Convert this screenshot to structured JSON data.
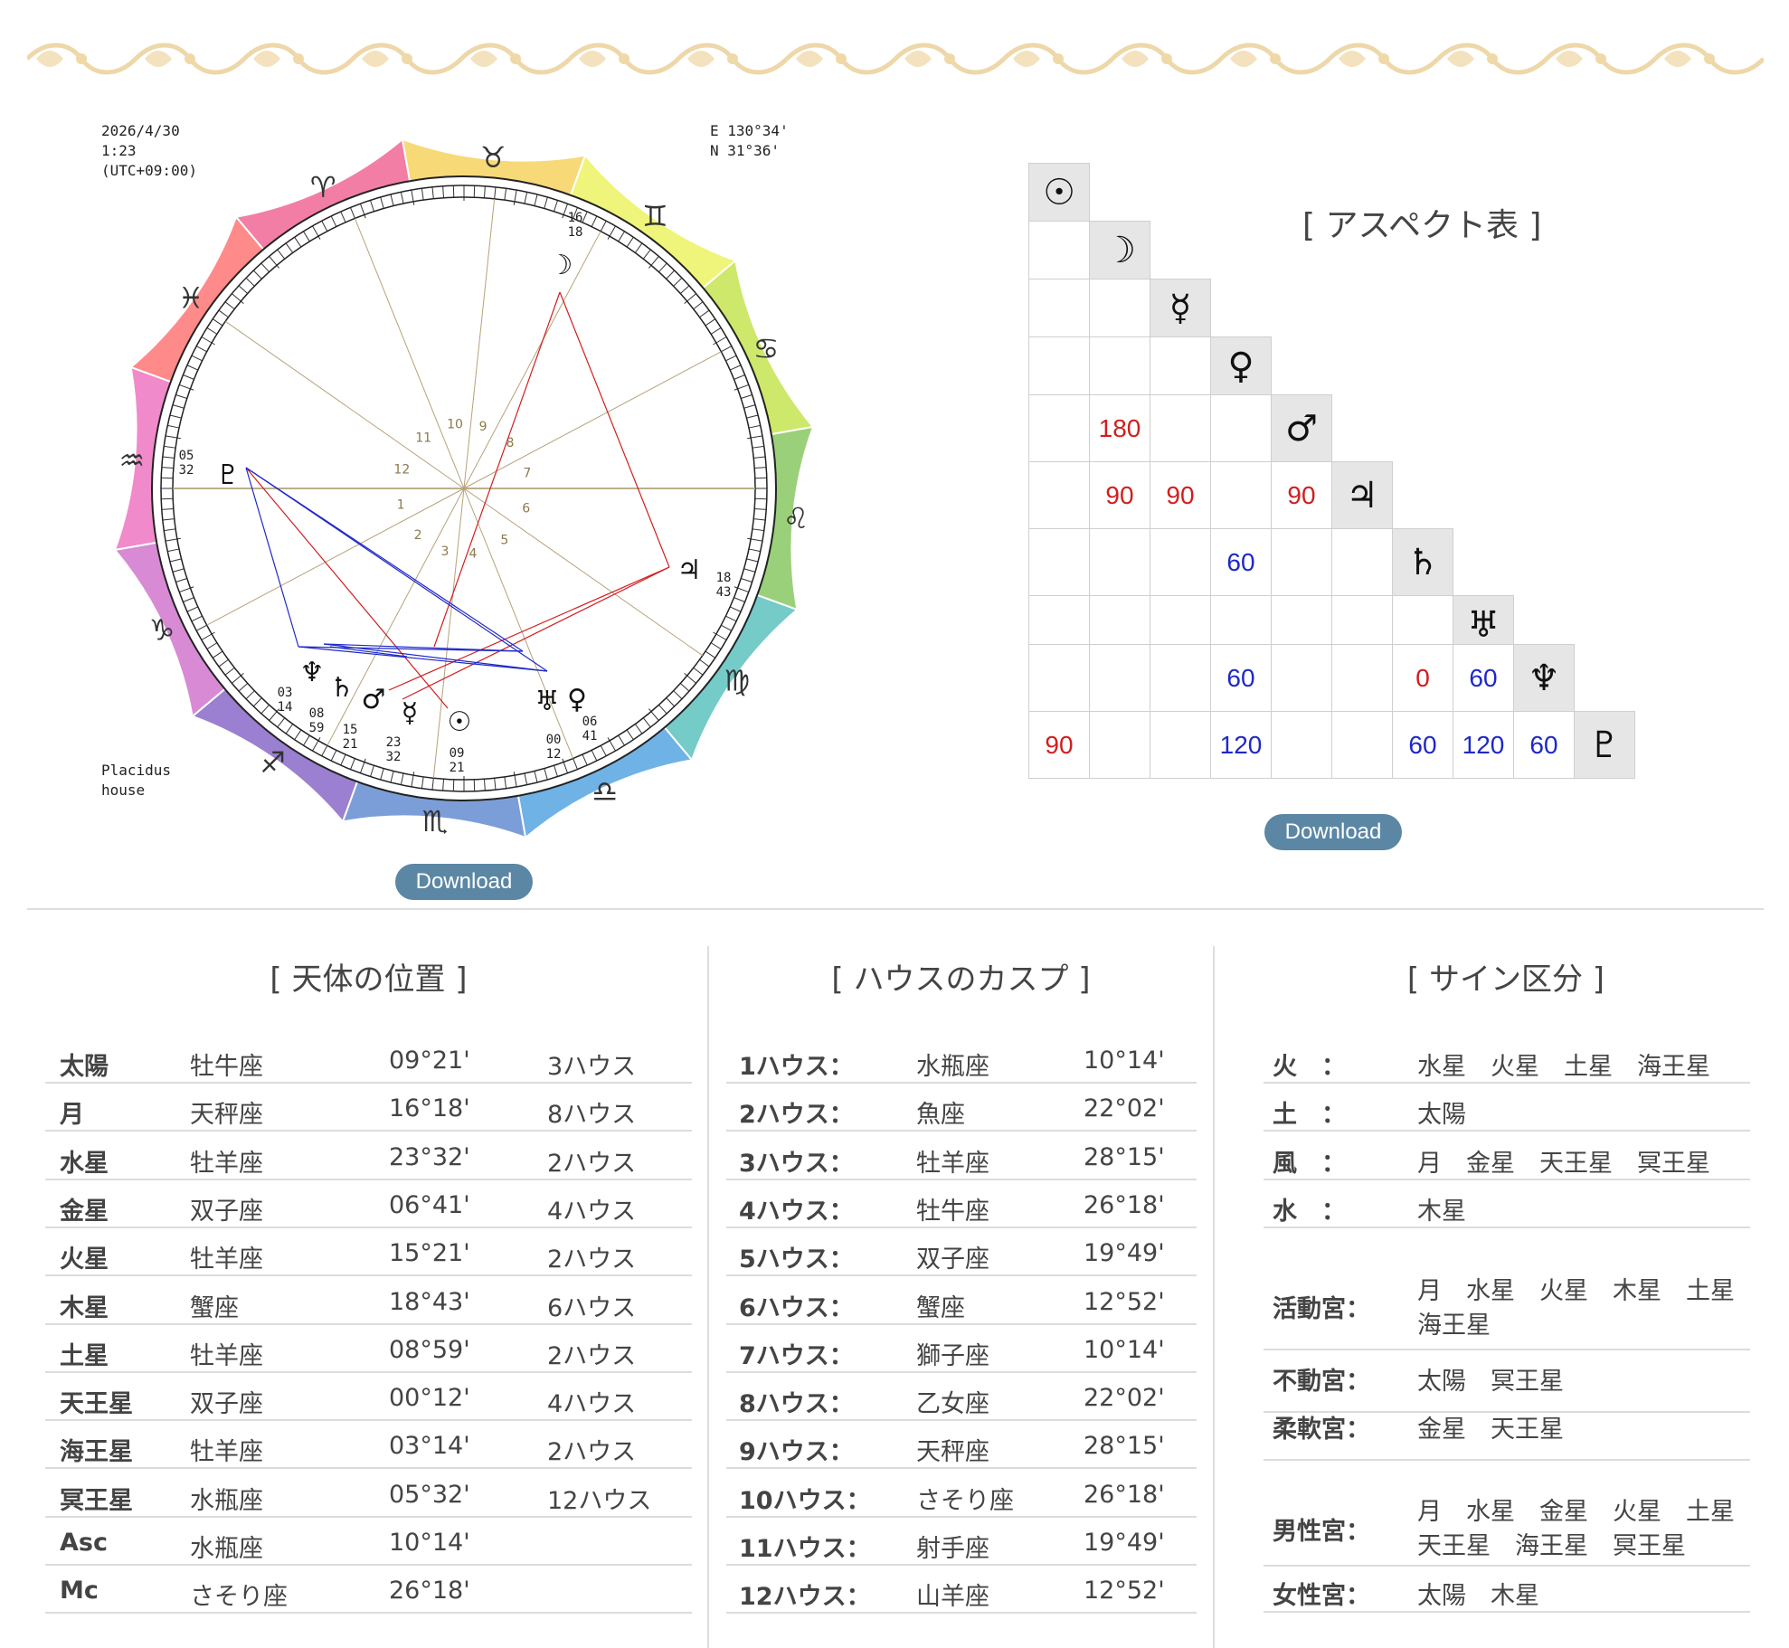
{
  "chart": {
    "date": "2026/4/30",
    "time": "1:23",
    "tz": "(UTC+09:00)",
    "lon": "E 130°34'",
    "lat": "N 31°36'",
    "system_line1": "Placidus",
    "system_line2": "house",
    "signs": [
      "♈",
      "♉",
      "♊",
      "♋",
      "♌",
      "♍",
      "♎",
      "♏",
      "♐",
      "♑",
      "♒",
      "♓"
    ],
    "sign_colors": [
      "#f37ea5",
      "#f7d977",
      "#eef57a",
      "#cde86a",
      "#9ad07a",
      "#74cbc8",
      "#6fb2e6",
      "#7b9ed8",
      "#9b7fd0",
      "#d88ad4",
      "#f08acb",
      "#ff8a8a"
    ],
    "house_numbers": [
      "1",
      "2",
      "3",
      "4",
      "5",
      "6",
      "7",
      "8",
      "9",
      "10",
      "11",
      "12"
    ],
    "planets": [
      {
        "symbol": "☉",
        "deg": "09",
        "min": "21"
      },
      {
        "symbol": "☽",
        "deg": "16",
        "min": "18"
      },
      {
        "symbol": "☿",
        "deg": "23",
        "min": "32"
      },
      {
        "symbol": "♀",
        "deg": "06",
        "min": "41"
      },
      {
        "symbol": "♂",
        "deg": "15",
        "min": "21"
      },
      {
        "symbol": "♃",
        "deg": "18",
        "min": "43"
      },
      {
        "symbol": "♄",
        "deg": "08",
        "min": "59"
      },
      {
        "symbol": "♅",
        "deg": "00",
        "min": "12"
      },
      {
        "symbol": "♆",
        "deg": "03",
        "min": "14"
      },
      {
        "symbol": "♇",
        "deg": "05",
        "min": "32"
      }
    ],
    "download": "Download"
  },
  "aspect": {
    "title": "[ アスペクト表 ]",
    "symbols": [
      "☉",
      "☽",
      "☿",
      "♀",
      "♂",
      "♃",
      "♄",
      "♅",
      "♆",
      "♇"
    ],
    "cells": [
      {
        "r": 4,
        "c": 1,
        "v": "180",
        "kind": "red"
      },
      {
        "r": 5,
        "c": 1,
        "v": "90",
        "kind": "red"
      },
      {
        "r": 5,
        "c": 2,
        "v": "90",
        "kind": "red"
      },
      {
        "r": 5,
        "c": 4,
        "v": "90",
        "kind": "red"
      },
      {
        "r": 6,
        "c": 3,
        "v": "60",
        "kind": "blue"
      },
      {
        "r": 8,
        "c": 3,
        "v": "60",
        "kind": "blue"
      },
      {
        "r": 8,
        "c": 6,
        "v": "0",
        "kind": "red"
      },
      {
        "r": 8,
        "c": 7,
        "v": "60",
        "kind": "blue"
      },
      {
        "r": 9,
        "c": 0,
        "v": "90",
        "kind": "red"
      },
      {
        "r": 9,
        "c": 3,
        "v": "120",
        "kind": "blue"
      },
      {
        "r": 9,
        "c": 6,
        "v": "60",
        "kind": "blue"
      },
      {
        "r": 9,
        "c": 7,
        "v": "120",
        "kind": "blue"
      },
      {
        "r": 9,
        "c": 8,
        "v": "60",
        "kind": "blue"
      }
    ],
    "download": "Download"
  },
  "planet_positions": {
    "title": "[ 天体の位置 ]",
    "rows": [
      {
        "name": "太陽",
        "sign": "牡牛座",
        "pos": "09°21'",
        "house": "3ハウス"
      },
      {
        "name": "月",
        "sign": "天秤座",
        "pos": "16°18'",
        "house": "8ハウス"
      },
      {
        "name": "水星",
        "sign": "牡羊座",
        "pos": "23°32'",
        "house": "2ハウス"
      },
      {
        "name": "金星",
        "sign": "双子座",
        "pos": "06°41'",
        "house": "4ハウス"
      },
      {
        "name": "火星",
        "sign": "牡羊座",
        "pos": "15°21'",
        "house": "2ハウス"
      },
      {
        "name": "木星",
        "sign": "蟹座",
        "pos": "18°43'",
        "house": "6ハウス"
      },
      {
        "name": "土星",
        "sign": "牡羊座",
        "pos": "08°59'",
        "house": "2ハウス"
      },
      {
        "name": "天王星",
        "sign": "双子座",
        "pos": "00°12'",
        "house": "4ハウス"
      },
      {
        "name": "海王星",
        "sign": "牡羊座",
        "pos": "03°14'",
        "house": "2ハウス"
      },
      {
        "name": "冥王星",
        "sign": "水瓶座",
        "pos": "05°32'",
        "house": "12ハウス"
      },
      {
        "name": "Asc",
        "sign": "水瓶座",
        "pos": "10°14'",
        "house": ""
      },
      {
        "name": "Mc",
        "sign": "さそり座",
        "pos": "26°18'",
        "house": ""
      }
    ]
  },
  "house_cusps": {
    "title": "[ ハウスのカスプ ]",
    "rows": [
      {
        "name": "1ハウス：",
        "sign": "水瓶座",
        "pos": "10°14'"
      },
      {
        "name": "2ハウス：",
        "sign": "魚座",
        "pos": "22°02'"
      },
      {
        "name": "3ハウス：",
        "sign": "牡羊座",
        "pos": "28°15'"
      },
      {
        "name": "4ハウス：",
        "sign": "牡牛座",
        "pos": "26°18'"
      },
      {
        "name": "5ハウス：",
        "sign": "双子座",
        "pos": "19°49'"
      },
      {
        "name": "6ハウス：",
        "sign": "蟹座",
        "pos": "12°52'"
      },
      {
        "name": "7ハウス：",
        "sign": "獅子座",
        "pos": "10°14'"
      },
      {
        "name": "8ハウス：",
        "sign": "乙女座",
        "pos": "22°02'"
      },
      {
        "name": "9ハウス：",
        "sign": "天秤座",
        "pos": "28°15'"
      },
      {
        "name": "10ハウス：",
        "sign": "さそり座",
        "pos": "26°18'"
      },
      {
        "name": "11ハウス：",
        "sign": "射手座",
        "pos": "19°49'"
      },
      {
        "name": "12ハウス：",
        "sign": "山羊座",
        "pos": "12°52'"
      }
    ]
  },
  "sign_division": {
    "title": "[ サイン区分 ]",
    "element_rows": [
      {
        "name": "火　：",
        "items": "水星　火星　土星　海王星"
      },
      {
        "name": "土　：",
        "items": "太陽"
      },
      {
        "name": "風　：",
        "items": "月　金星　天王星　冥王星"
      },
      {
        "name": "水　：",
        "items": "木星"
      }
    ],
    "quality_rows": [
      {
        "name": "活動宮：",
        "line1": "月　水星　火星　木星　土星",
        "line2": "海王星"
      },
      {
        "name": "不動宮：",
        "line1": "太陽　冥王星",
        "line2": ""
      },
      {
        "name": "柔軟宮：",
        "line1": "金星　天王星",
        "line2": ""
      }
    ],
    "gender_rows": [
      {
        "name": "男性宮：",
        "line1": "月　水星　金星　火星　土星",
        "line2": "天王星　海王星　冥王星"
      },
      {
        "name": "女性宮：",
        "line1": "太陽　木星",
        "line2": ""
      }
    ]
  }
}
